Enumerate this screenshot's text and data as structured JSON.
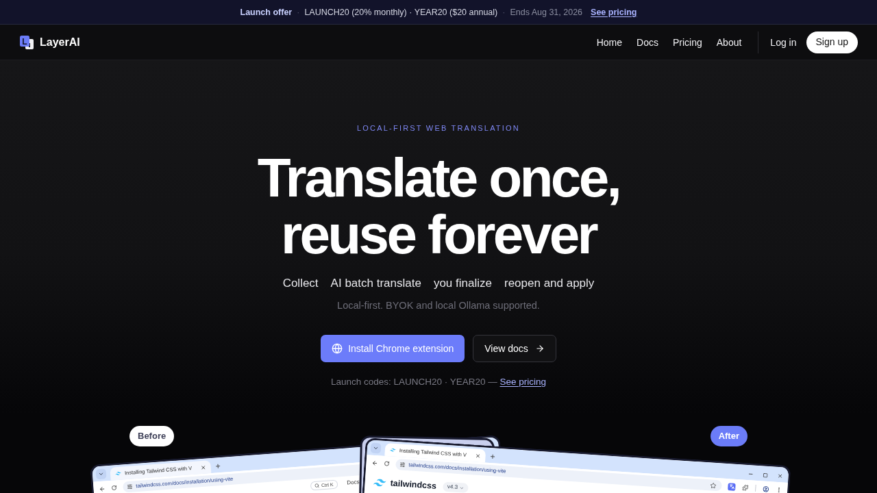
{
  "banner": {
    "parts": [
      {
        "kind": "label",
        "text": "Launch offer"
      },
      {
        "kind": "separator",
        "text": "·"
      },
      {
        "kind": "text",
        "text": "LAUNCH20 (20% monthly) · YEAR20 ($20 annual)"
      },
      {
        "kind": "separator",
        "text": "·"
      },
      {
        "kind": "muted",
        "text": "Ends Aug 31, 2026"
      },
      {
        "kind": "link",
        "text": "See pricing"
      }
    ]
  },
  "nav": {
    "logo_letter": "L",
    "brand": "LayerAI",
    "links": [
      {
        "label": "Home"
      },
      {
        "label": "Docs"
      },
      {
        "label": "Pricing"
      },
      {
        "label": "About"
      }
    ],
    "login": "Log in",
    "signup": "Sign up"
  },
  "hero": {
    "eyebrow": "LOCAL-FIRST WEB TRANSLATION",
    "title_lines": [
      "Translate once,",
      "reuse forever"
    ],
    "steps": [
      "Collect",
      "AI batch translate",
      "you finalize",
      "reopen and apply"
    ],
    "note": "Local-first. BYOK and local Ollama supported.",
    "primary_button": "Install Chrome extension",
    "secondary_button": "View docs",
    "codes": "Launch codes: LAUNCH20 · YEAR20 —",
    "codes_link": "See pricing"
  },
  "showcase": {
    "badges": [
      {
        "kind": "before",
        "label": "Before"
      },
      {
        "kind": "after",
        "label": "After"
      }
    ],
    "windows": [
      {
        "kind": "before",
        "tab_title": "Installing Tailwind CSS with V",
        "url": "tailwindcss.com/docs/installation/using-vite",
        "search_hint": "Ctrl K",
        "nav_link": "Docs"
      },
      {
        "kind": "after",
        "tab_title": "Installing Tailwind CSS with V",
        "url": "tailwindcss.com/docs/installation/using-vite",
        "site_name": "tailwindcss",
        "version": "v4.3"
      }
    ]
  }
}
